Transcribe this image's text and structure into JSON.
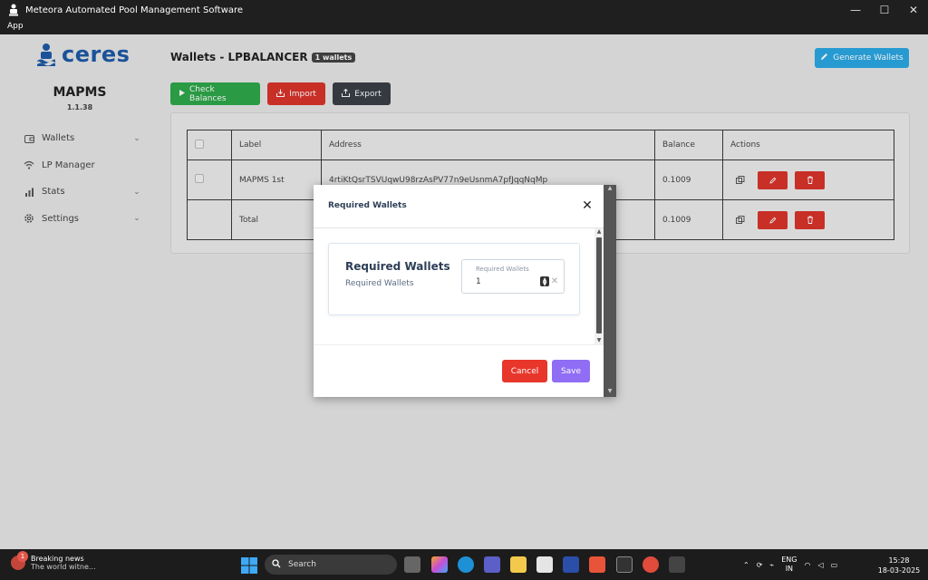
{
  "window": {
    "title": "Meteora Automated Pool Management Software",
    "menu_app": "App",
    "minimize": "—",
    "maximize": "☐",
    "close": "✕"
  },
  "sidebar": {
    "logo_text": "ceres",
    "brand": "MAPMS",
    "version": "1.1.38",
    "items": [
      {
        "label": "Wallets",
        "icon": "wallet-icon",
        "has_chevron": true
      },
      {
        "label": "LP Manager",
        "icon": "wifi-icon",
        "has_chevron": false
      },
      {
        "label": "Stats",
        "icon": "bar-chart-icon",
        "has_chevron": true
      },
      {
        "label": "Settings",
        "icon": "gear-icon",
        "has_chevron": true
      }
    ]
  },
  "header": {
    "title": "Wallets - LPBALANCER",
    "badge": "1 wallets",
    "generate_button": "Generate Wallets"
  },
  "toolbar": {
    "check_balances": "Check Balances",
    "import": "Import",
    "export": "Export"
  },
  "table": {
    "columns": [
      "Label",
      "Address",
      "Balance",
      "Actions"
    ],
    "rows": [
      {
        "label": "MAPMS 1st",
        "address": "4rtiKtQsrTSVUqwU98rzAsPV77n9eUsnmA7pfJqqNqMp",
        "balance": "0.1009"
      },
      {
        "label": "Total",
        "address": "",
        "balance": "0.1009"
      }
    ]
  },
  "modal": {
    "title": "Required Wallets",
    "card_title": "Required Wallets",
    "card_subtitle": "Required Wallets",
    "field_label": "Required Wallets",
    "field_value": "1",
    "close": "✕",
    "clear": "✕",
    "cancel": "Cancel",
    "save": "Save"
  },
  "taskbar": {
    "news_title": "Breaking news",
    "news_subtitle": "The world witne...",
    "news_count": "1",
    "search_placeholder": "Search",
    "lang": "ENG",
    "region": "IN",
    "time": "15:28",
    "date": "18-03-2025"
  },
  "colors": {
    "accent_blue": "#2aa8e3",
    "green": "#2ea84a",
    "red": "#d9342b",
    "dark": "#3a3f47",
    "purple": "#8f6df5",
    "logo_blue": "#1e5aa6"
  }
}
